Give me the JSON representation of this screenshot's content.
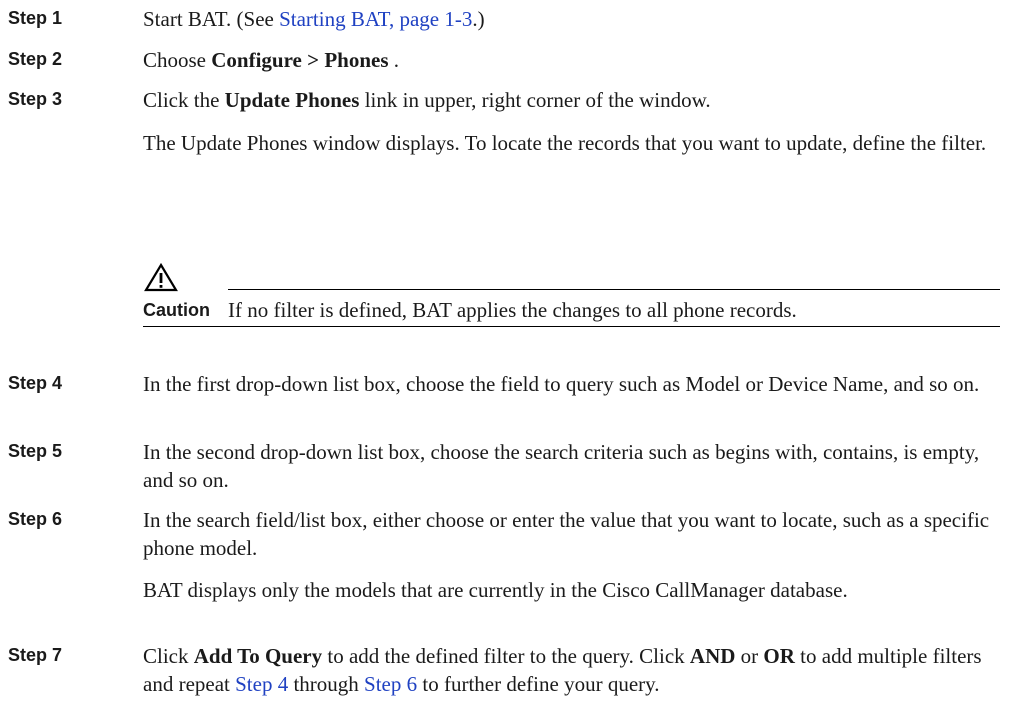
{
  "steps": [
    {
      "label": "Step 1",
      "pre": "Start BAT. (See ",
      "link": "Starting BAT, page 1-3",
      "post": ".)"
    },
    {
      "label": "Step 2",
      "pre": "Choose ",
      "bold": "Configure > Phones",
      "post": " ."
    },
    {
      "label": "Step 3",
      "pre": "Click the ",
      "bold": "Update Phones",
      "post": " link in upper, right corner of the window.",
      "followup": "The Update Phones window displays. To locate the records that you want to update, define the filter."
    },
    {
      "label": "Step 4",
      "text": "In the first drop-down list box, choose the field to query such as Model or Device Name, and so on."
    },
    {
      "label": "Step 5",
      "text": "In the second drop-down list box, choose the search criteria such as begins with, contains, is empty, and so on."
    },
    {
      "label": "Step 6",
      "text": "In the search field/list box, either choose or enter the value that you want to locate, such as a specific phone model.",
      "followup": "BAT displays only the models that are currently in the Cisco CallManager database."
    },
    {
      "label": "Step 7",
      "t1": "Click ",
      "b1": "Add To Query",
      "t2": " to add the defined filter to the query. Click ",
      "b2": "AND",
      "t3": " or ",
      "b3": "OR",
      "t4": " to add multiple filters and repeat ",
      "link1": "Step 4",
      "t5": " through ",
      "link2": "Step 6",
      "t6": " to further define your query."
    }
  ],
  "caution": {
    "label": "Caution",
    "text": "If no filter is defined, BAT applies the changes to all phone records."
  }
}
